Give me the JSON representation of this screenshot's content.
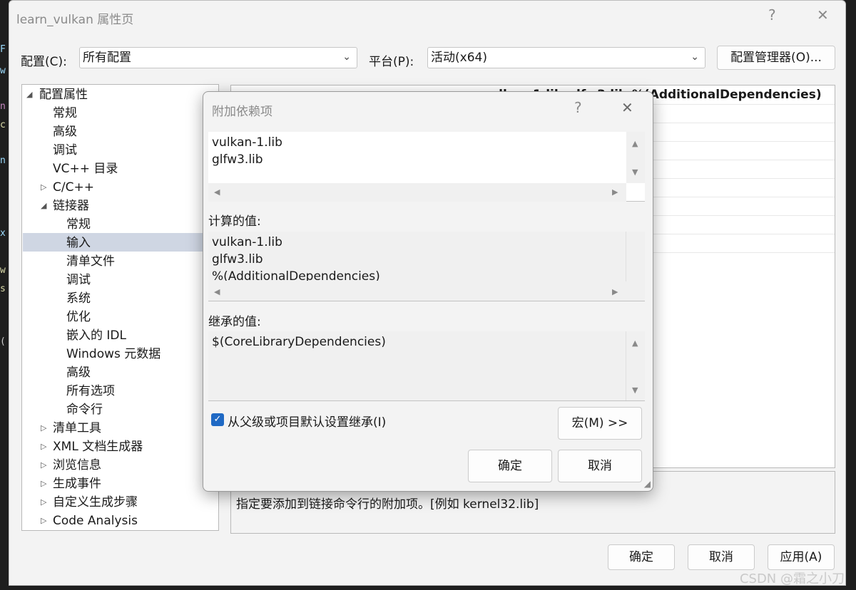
{
  "main_window": {
    "title": "learn_vulkan 属性页",
    "help": "?",
    "close": "✕",
    "config_label": "配置(C):",
    "config_value": "所有配置",
    "platform_label": "平台(P):",
    "platform_value": "活动(x64)",
    "config_manager_button": "配置管理器(O)...",
    "ok_button": "确定",
    "cancel_button": "取消",
    "apply_button": "应用(A)"
  },
  "tree": {
    "items": [
      {
        "label": "配置属性",
        "arrow": "◢"
      },
      {
        "label": "常规"
      },
      {
        "label": "高级"
      },
      {
        "label": "调试"
      },
      {
        "label": "VC++ 目录"
      },
      {
        "label": "C/C++",
        "arrow": "▷"
      },
      {
        "label": "链接器",
        "arrow": "◢"
      },
      {
        "label": "常规"
      },
      {
        "label": "输入"
      },
      {
        "label": "清单文件"
      },
      {
        "label": "调试"
      },
      {
        "label": "系统"
      },
      {
        "label": "优化"
      },
      {
        "label": "嵌入的 IDL"
      },
      {
        "label": "Windows 元数据"
      },
      {
        "label": "高级"
      },
      {
        "label": "所有选项"
      },
      {
        "label": "命令行"
      },
      {
        "label": "清单工具",
        "arrow": "▷"
      },
      {
        "label": "XML 文档生成器",
        "arrow": "▷"
      },
      {
        "label": "浏览信息",
        "arrow": "▷"
      },
      {
        "label": "生成事件",
        "arrow": "▷"
      },
      {
        "label": "自定义生成步骤",
        "arrow": "▷"
      },
      {
        "label": "Code Analysis",
        "arrow": "▷"
      }
    ]
  },
  "grid": {
    "row_name": "附加依赖项",
    "row_value": "vulkan-1.lib;glfw3.lib;%(AdditionalDependencies)"
  },
  "description": "指定要添加到链接命令行的附加项。[例如 kernel32.lib]",
  "dialog": {
    "title": "附加依赖项",
    "help": "?",
    "close": "✕",
    "edit_lines": [
      "vulkan-1.lib",
      "glfw3.lib"
    ],
    "computed_label": "计算的值:",
    "computed_lines": [
      "vulkan-1.lib",
      "glfw3.lib",
      "%(AdditionalDependencies)"
    ],
    "inherited_label": "继承的值:",
    "inherited_lines": [
      "$(CoreLibraryDependencies)"
    ],
    "inherit_checkbox_label": "从父级或项目默认设置继承(I)",
    "inherit_checked": true,
    "macro_button": "宏(M) >>",
    "ok_button": "确定",
    "cancel_button": "取消"
  },
  "watermark": "CSDN @霜之小刀",
  "colors": {
    "accent": "#1f69c4",
    "selection": "#cfd6e3",
    "window_bg": "#f3f3f3"
  }
}
